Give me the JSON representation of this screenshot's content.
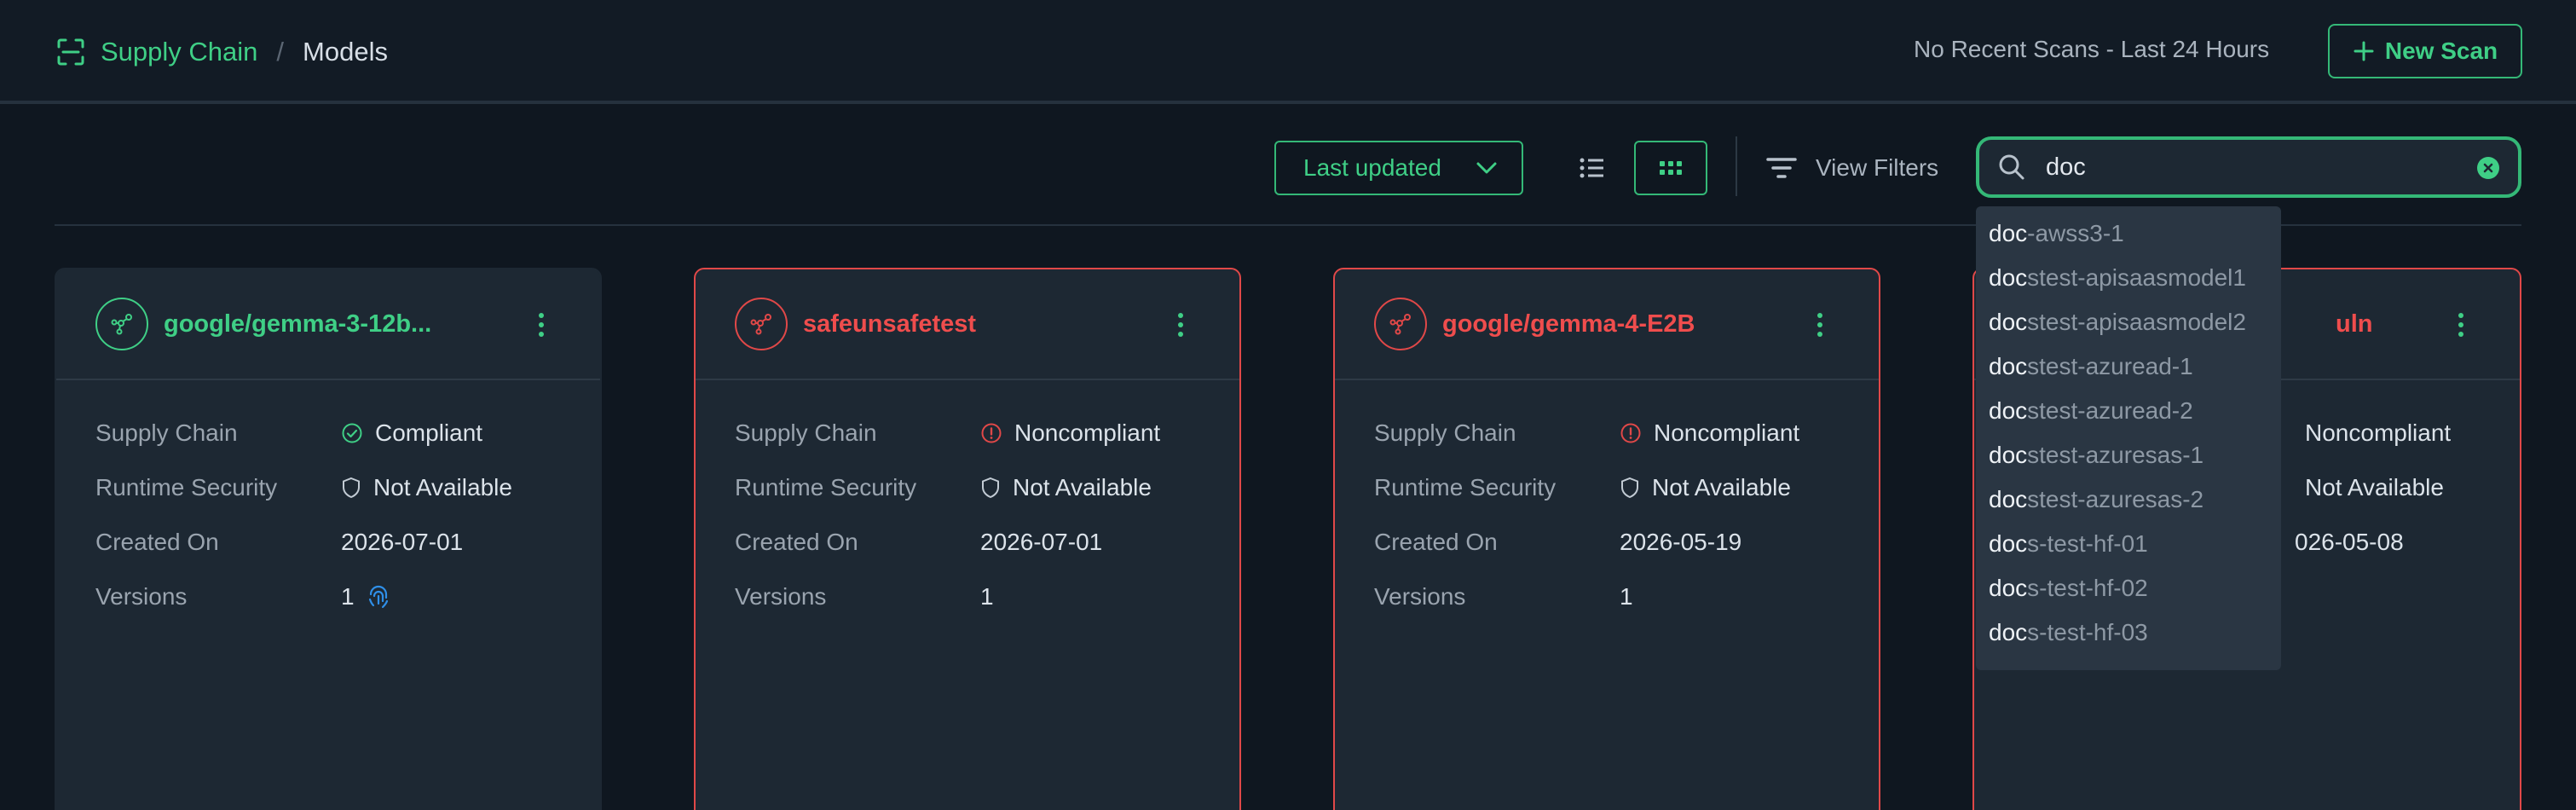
{
  "header": {
    "breadcrumb_root": "Supply Chain",
    "breadcrumb_sep": "/",
    "breadcrumb_current": "Models",
    "recent_scans": "No Recent Scans - Last 24 Hours",
    "new_scan_label": "New Scan"
  },
  "toolbar": {
    "sort_label": "Last updated",
    "filters_label": "View Filters",
    "search_value": "doc"
  },
  "search_suggestions": [
    {
      "match": "doc",
      "rest": "-awss3-1"
    },
    {
      "match": "doc",
      "rest": "stest-apisaasmodel1"
    },
    {
      "match": "doc",
      "rest": "stest-apisaasmodel2"
    },
    {
      "match": "doc",
      "rest": "stest-azuread-1"
    },
    {
      "match": "doc",
      "rest": "stest-azuread-2"
    },
    {
      "match": "doc",
      "rest": "stest-azuresas-1"
    },
    {
      "match": "doc",
      "rest": "stest-azuresas-2"
    },
    {
      "match": "doc",
      "rest": "s-test-hf-01"
    },
    {
      "match": "doc",
      "rest": "s-test-hf-02"
    },
    {
      "match": "doc",
      "rest": "s-test-hf-03"
    }
  ],
  "field_labels": {
    "supply_chain": "Supply Chain",
    "runtime_security": "Runtime Security",
    "created_on": "Created On",
    "versions": "Versions"
  },
  "cards": [
    {
      "title": "google/gemma-3-12b...",
      "supply_chain": "Compliant",
      "runtime_security": "Not Available",
      "created_on": "2026-07-01",
      "versions": "1"
    },
    {
      "title": "safeunsafetest",
      "supply_chain": "Noncompliant",
      "runtime_security": "Not Available",
      "created_on": "2026-07-01",
      "versions": "1"
    },
    {
      "title": "google/gemma-4-E2B",
      "supply_chain": "Noncompliant",
      "runtime_security": "Not Available",
      "created_on": "2026-05-19",
      "versions": "1"
    },
    {
      "title": "uln",
      "supply_chain": "Noncompliant",
      "runtime_security": "Not Available",
      "created_on": "026-05-08"
    }
  ],
  "colors": {
    "accent": "#3fcf86",
    "danger": "#e04848",
    "background": "#0f1720",
    "card": "#1d2833",
    "fingerprint": "#2f8fe8"
  },
  "icons": [
    "scan-frame-icon",
    "plus-icon",
    "chevron-down-icon",
    "list-view-icon",
    "grid-view-icon",
    "filter-icon",
    "search-icon",
    "clear-icon",
    "model-icon",
    "kebab-icon",
    "check-circle-icon",
    "alert-circle-icon",
    "shield-icon",
    "fingerprint-icon"
  ]
}
